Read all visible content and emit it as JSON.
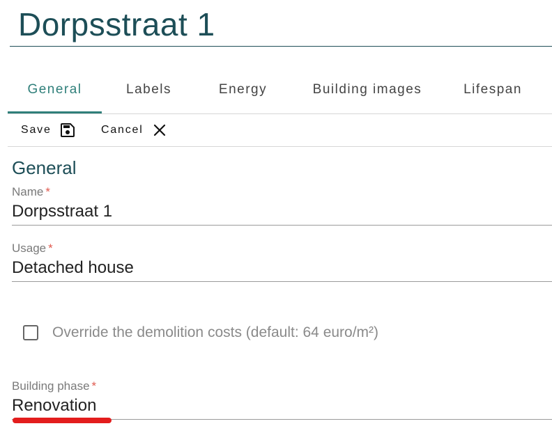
{
  "header": {
    "title": "Dorpsstraat 1"
  },
  "tabs": [
    {
      "label": "General",
      "active": true
    },
    {
      "label": "Labels"
    },
    {
      "label": "Energy"
    },
    {
      "label": "Building images"
    },
    {
      "label": "Lifespan"
    }
  ],
  "toolbar": {
    "save_label": "Save",
    "save_icon": "floppy-disk-icon",
    "cancel_label": "Cancel",
    "cancel_icon": "close-icon"
  },
  "section": {
    "title": "General"
  },
  "fields": {
    "name": {
      "label": "Name",
      "required_mark": "*",
      "value": "Dorpsstraat 1"
    },
    "usage": {
      "label": "Usage",
      "required_mark": "*",
      "value": "Detached house"
    },
    "override_demolition": {
      "label": "Override the demolition costs (default: 64 euro/m²)",
      "checked": false
    },
    "building_phase": {
      "label": "Building phase",
      "required_mark": "*",
      "value": "Renovation"
    }
  },
  "colors": {
    "accent": "#2f7f7a",
    "title": "#1d4e57",
    "required": "#e05a4f",
    "highlight": "#e31d1d"
  }
}
